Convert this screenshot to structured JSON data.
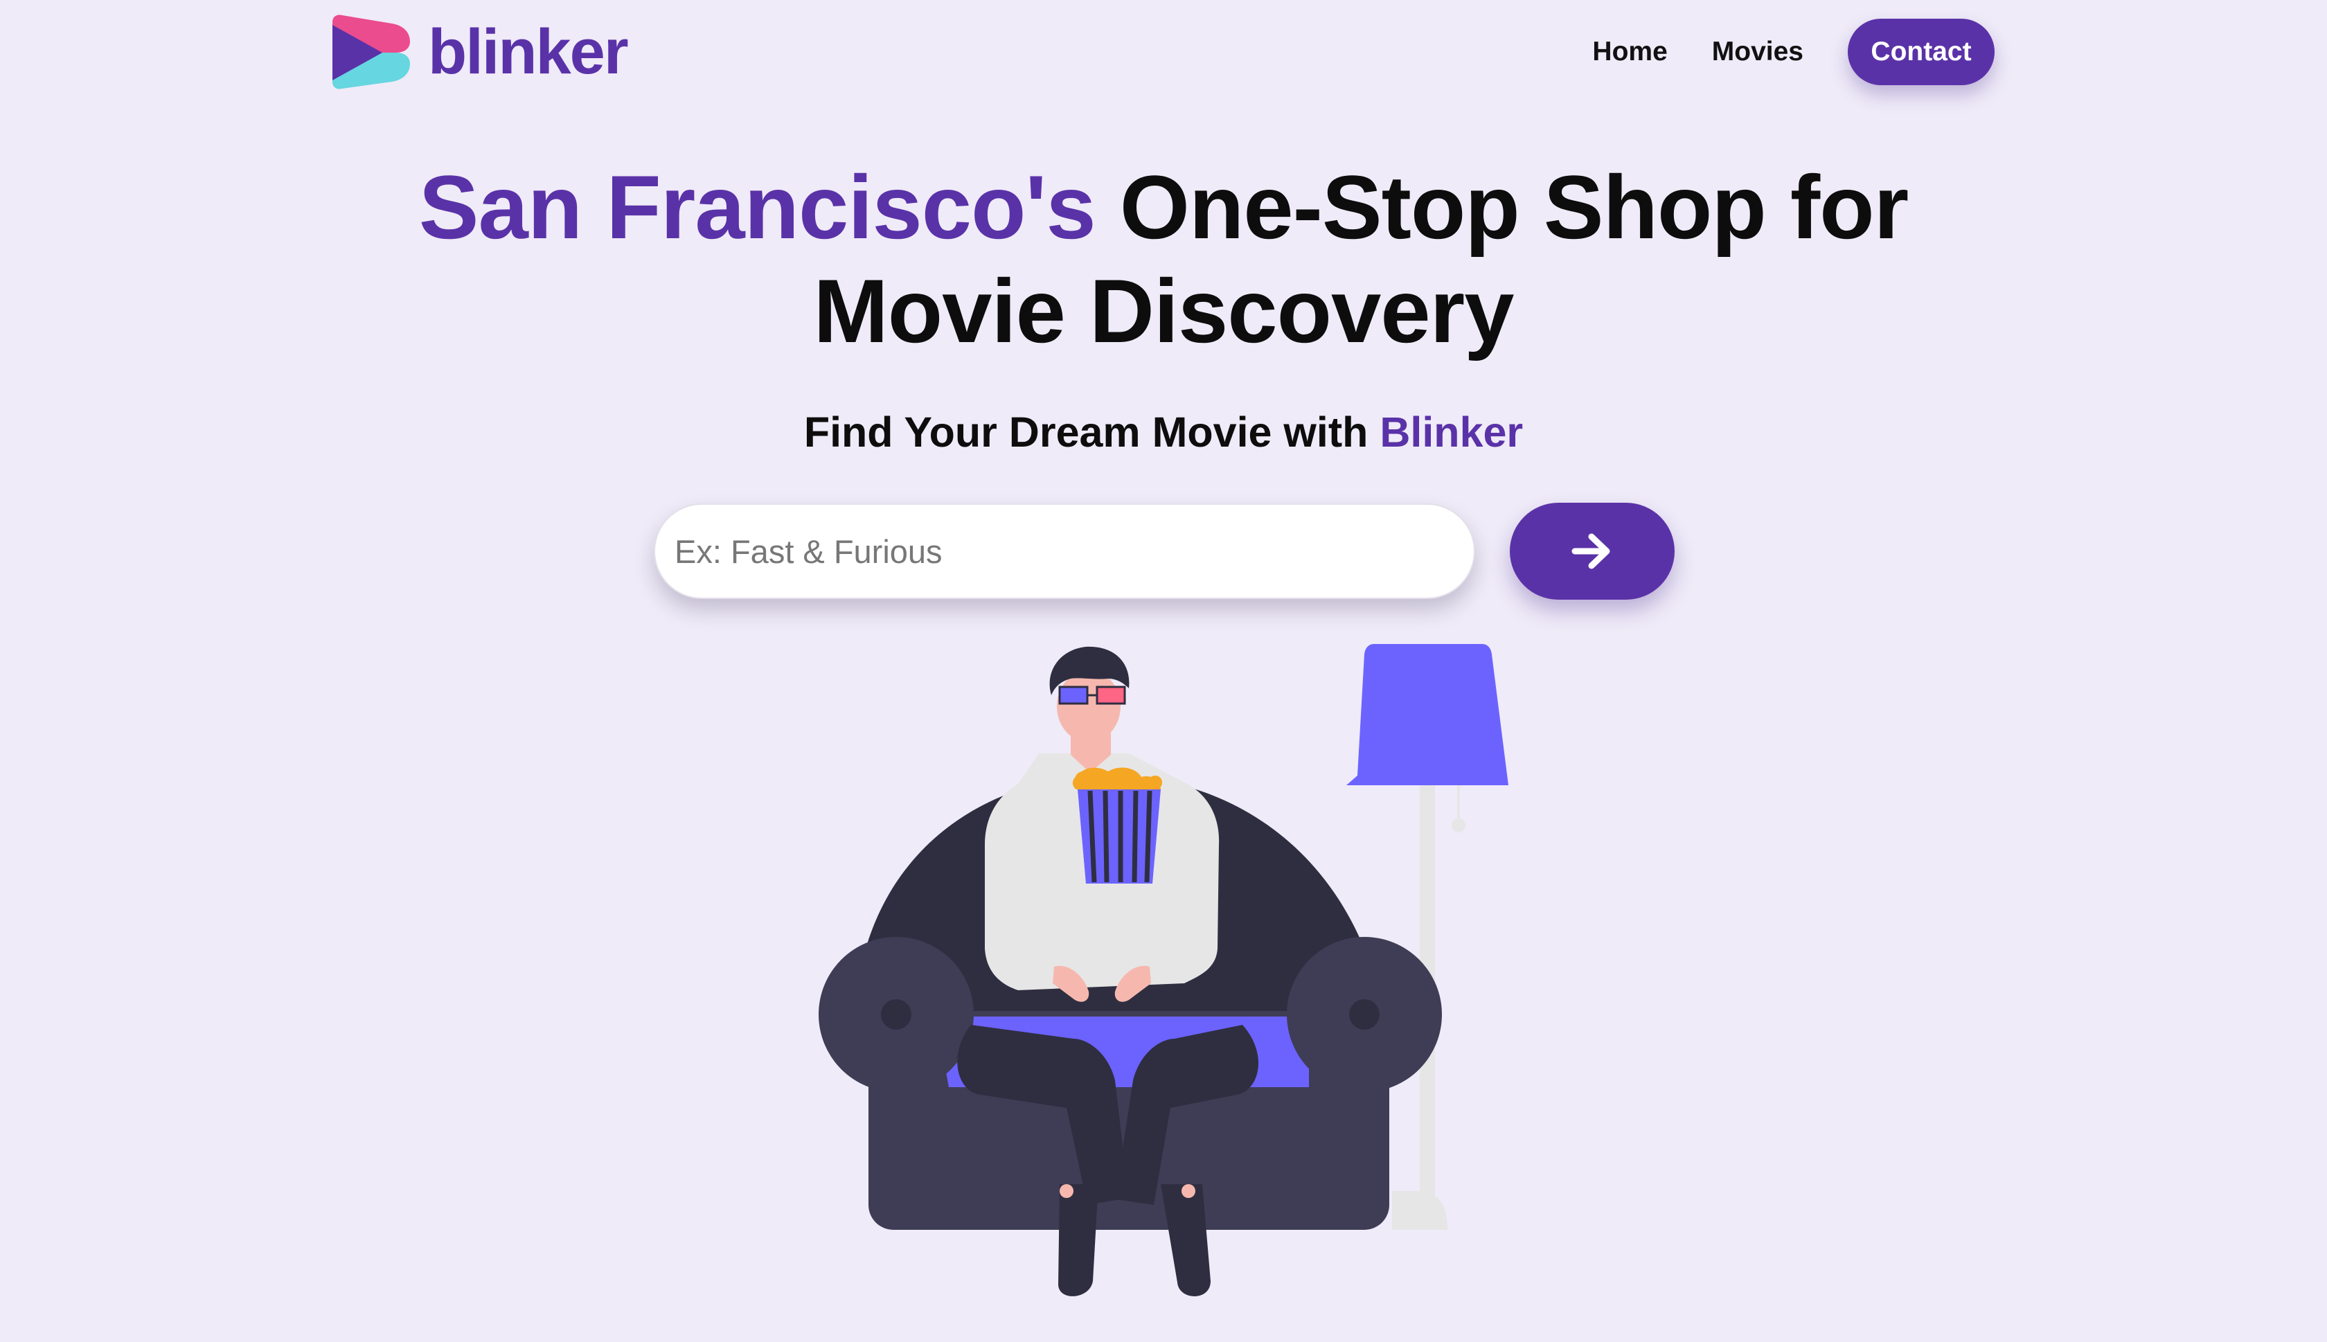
{
  "brand": {
    "name": "blinker",
    "colors": {
      "primary": "#5a32a8",
      "logo_pink": "#ea4c8d",
      "logo_cyan": "#66d6e0",
      "background": "#efebf8"
    }
  },
  "nav": {
    "home": "Home",
    "movies": "Movies",
    "contact": "Contact"
  },
  "hero": {
    "title_accent": "San Francisco's",
    "title_rest_line1": "One-Stop Shop for",
    "title_line2": "Movie Discovery",
    "subtitle_prefix": "Find Your Dream Movie with",
    "subtitle_accent": "Blinker"
  },
  "search": {
    "placeholder": "Ex: Fast & Furious",
    "value": "",
    "submit_icon": "arrow-right-icon"
  },
  "illustration": {
    "subject": "man-on-armchair-with-popcorn-and-3d-glasses",
    "colors": {
      "chair": "#3f3d56",
      "seat": "#6c63ff",
      "lamp_shade": "#6c63ff",
      "lamp_pole": "#e6e6e6",
      "shirt": "#e6e6e6",
      "pants": "#2f2e41",
      "skin": "#f6b8ae",
      "popcorn": "#f5a623"
    }
  }
}
